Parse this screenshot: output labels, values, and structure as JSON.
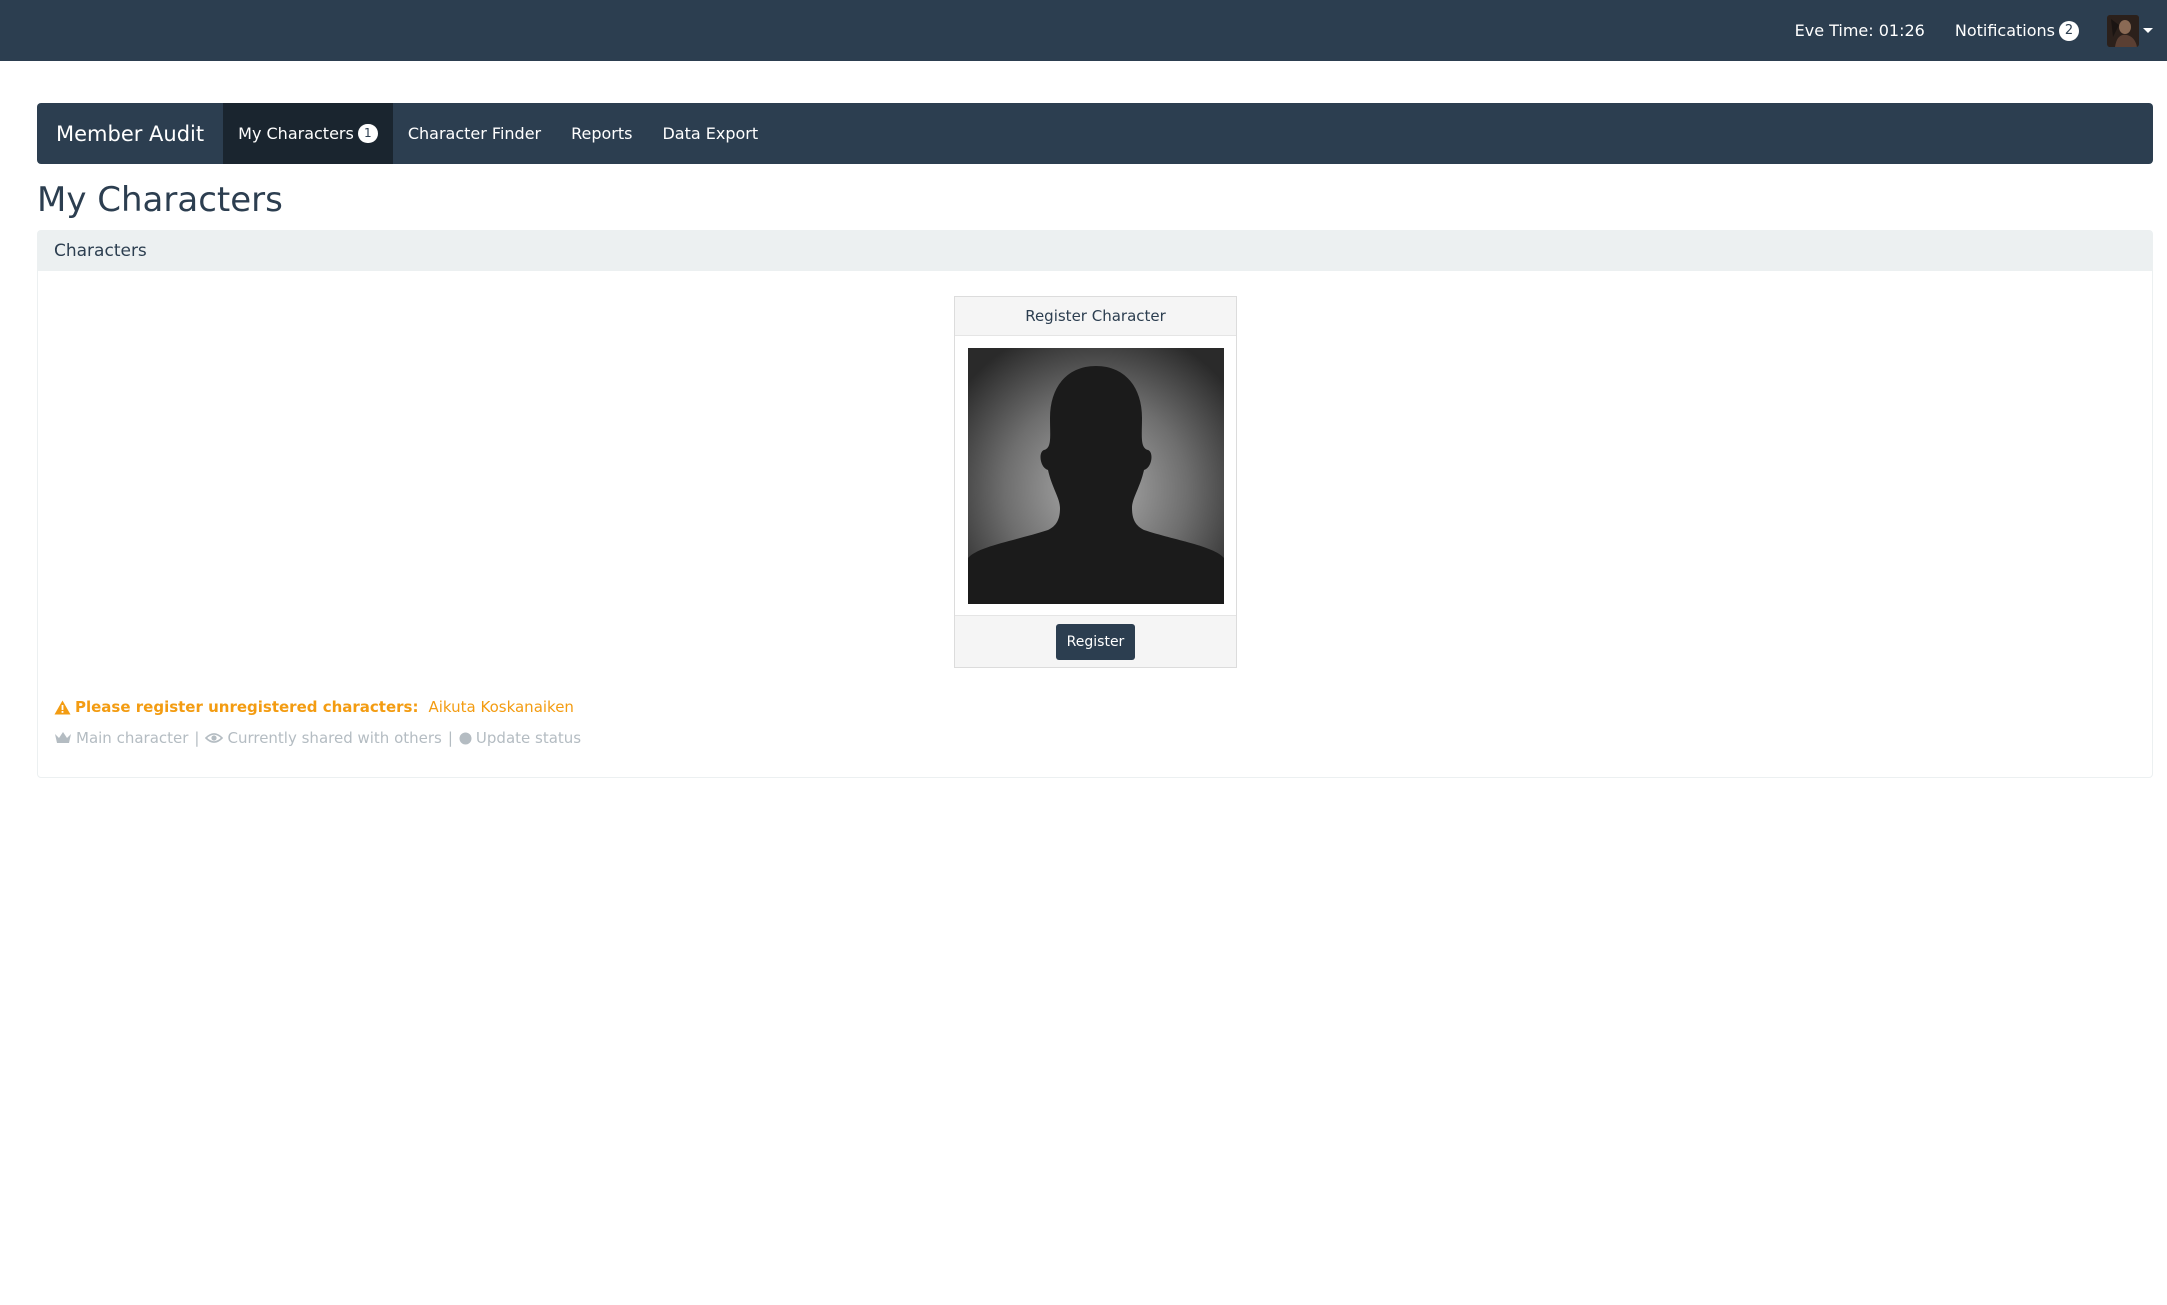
{
  "topbar": {
    "eve_time": "Eve Time: 01:26",
    "notifications_label": "Notifications",
    "notifications_count": "2",
    "avatar_icon": "user-avatar"
  },
  "appnav": {
    "brand": "Member Audit",
    "items": [
      {
        "label": "My Characters",
        "badge": "1",
        "active": true
      },
      {
        "label": "Character Finder"
      },
      {
        "label": "Reports"
      },
      {
        "label": "Data Export"
      }
    ]
  },
  "page": {
    "title": "My Characters"
  },
  "panel": {
    "heading": "Characters",
    "card": {
      "title": "Register Character",
      "button": "Register"
    },
    "warning": {
      "text": "Please register unregistered characters:",
      "character": "Aikuta Koskanaiken"
    },
    "legend": {
      "main": "Main character",
      "shared": "Currently shared with others",
      "status": "Update status",
      "separator": "|"
    }
  },
  "colors": {
    "navbar": "#2c3e50",
    "warning": "#f39c12",
    "muted": "#b4bcc2"
  }
}
